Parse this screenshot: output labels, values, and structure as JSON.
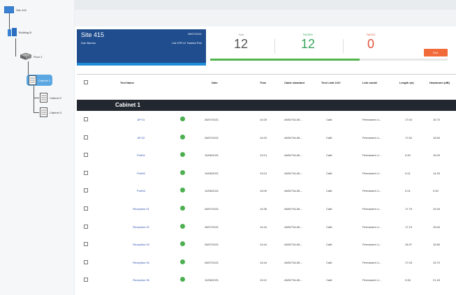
{
  "tree": {
    "site": "Site 415",
    "building": "Building B",
    "floor": "Floor 2",
    "cabinets": [
      "Cabinet 1",
      "Cabinet 2",
      "Cabinet 3"
    ],
    "selected": "Cabinet 1"
  },
  "site_panel": {
    "name": "Site 415",
    "owner": "Dan Barnes",
    "date": "28/07/2021",
    "test_info": "Cat 5TR-IV Twisted Pair"
  },
  "stats": [
    {
      "label": "Total",
      "value": "12",
      "color": "#555555"
    },
    {
      "label": "PASSED",
      "value": "12",
      "color": "#3ba55c"
    },
    {
      "label": "FAILED",
      "value": "0",
      "color": "#e0533d"
    }
  ],
  "fail_button": "FAIL",
  "columns": [
    "Test Name",
    "Date",
    "Time",
    "Cable standard",
    "Test Limit LDV",
    "Link model",
    "Length (m)",
    "Headroom (dB)"
  ],
  "group": "Cabinet 1",
  "rows": [
    {
      "name": "AP 01",
      "date": "28/07/2021",
      "time": "14:25",
      "std": "ANSI/TIA-56...",
      "limit": "Cat6",
      "model": "Permanent Li...",
      "length": "17.04",
      "headroom": "15.70"
    },
    {
      "name": "AP 02",
      "date": "28/07/2021",
      "time": "14:23",
      "std": "ANSI/TIA-56...",
      "limit": "Cat6",
      "model": "Permanent Li...",
      "length": "17.62",
      "headroom": "15.60"
    },
    {
      "name": "Port01",
      "date": "10/06/2021",
      "time": "13:13",
      "std": "ANSI/TIA-56...",
      "limit": "Cat6",
      "model": "Permanent Li...",
      "length": "0.00",
      "headroom": "15.00"
    },
    {
      "name": "Port02",
      "date": "10/06/2021",
      "time": "13:13",
      "std": "ANSI/TIA-56...",
      "limit": "Cat6",
      "model": "Permanent Li...",
      "length": "0.01",
      "headroom": "14.90"
    },
    {
      "name": "Port03",
      "date": "10/06/2021",
      "time": "14:09",
      "std": "ANSI/TIA-56...",
      "limit": "Cat6",
      "model": "Permanent Li...",
      "length": "0.01",
      "headroom": "0.00"
    },
    {
      "name": "Reception 01",
      "date": "28/07/2021",
      "time": "14:35",
      "std": "ANSI/TIA-56...",
      "limit": "Cat6",
      "model": "Permanent Li...",
      "length": "17.75",
      "headroom": "15.40"
    },
    {
      "name": "Reception 02",
      "date": "28/07/2021",
      "time": "14:44",
      "std": "ANSI/TIA-56...",
      "limit": "Cat6",
      "model": "Permanent Li...",
      "length": "17.19",
      "headroom": "15.60"
    },
    {
      "name": "Reception 03",
      "date": "28/07/2021",
      "time": "14:44",
      "std": "ANSI/TIA-56...",
      "limit": "Cat6",
      "model": "Permanent Li...",
      "length": "16.97",
      "headroom": "15.80"
    },
    {
      "name": "Reception 04",
      "date": "28/07/2021",
      "time": "14:44",
      "std": "ANSI/TIA-56...",
      "limit": "Cat6",
      "model": "Permanent Li...",
      "length": "17.03",
      "headroom": "15.70"
    },
    {
      "name": "Reception 05",
      "date": "10/06/2021",
      "time": "13:12",
      "std": "ANSI/TIA-56...",
      "limit": "Cat6",
      "model": "Permanent Li...",
      "length": "0.06",
      "headroom": "21.40"
    }
  ]
}
